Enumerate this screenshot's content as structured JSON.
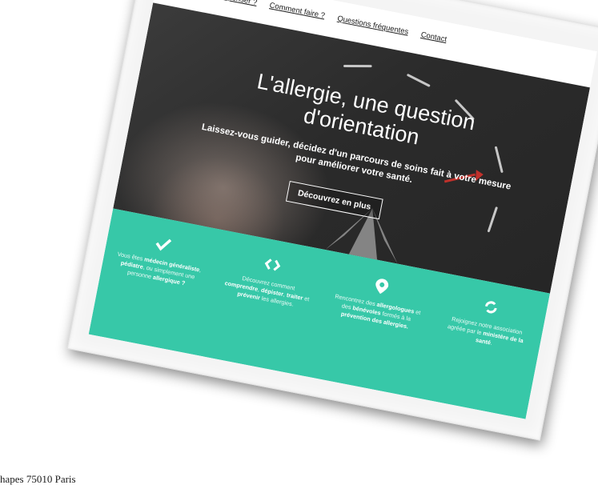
{
  "nav": {
    "logo_icon": "compass-icon",
    "links": [
      "Quand y penser ?",
      "Comment faire ?",
      "Questions fréquentes",
      "Contact"
    ]
  },
  "hero": {
    "title": "L'allergie, une question d'orientation",
    "subtitle": "Laissez-vous guider, décidez d'un parcours de soins fait à votre mesure pour améliorer votre santé.",
    "button_label": "Découvrez en plus"
  },
  "features": [
    {
      "icon": "checkmark-icon",
      "parts": [
        {
          "t": "Vous êtes ",
          "b": false
        },
        {
          "t": "médecin généraliste",
          "b": true
        },
        {
          "t": ", ",
          "b": false
        },
        {
          "t": "pédiatre",
          "b": true
        },
        {
          "t": ", ou simplement une personne ",
          "b": false
        },
        {
          "t": "allergique ?",
          "b": true
        }
      ]
    },
    {
      "icon": "code-brackets-icon",
      "parts": [
        {
          "t": "Découvrez comment ",
          "b": false
        },
        {
          "t": "comprendre",
          "b": true
        },
        {
          "t": ", ",
          "b": false
        },
        {
          "t": "dépister",
          "b": true
        },
        {
          "t": ", ",
          "b": false
        },
        {
          "t": "traiter",
          "b": true
        },
        {
          "t": " et ",
          "b": false
        },
        {
          "t": "prévenir",
          "b": true
        },
        {
          "t": " les allergies.",
          "b": false
        }
      ]
    },
    {
      "icon": "map-pin-icon",
      "parts": [
        {
          "t": "Rencontrez des ",
          "b": false
        },
        {
          "t": "allergologues",
          "b": true
        },
        {
          "t": " et des ",
          "b": false
        },
        {
          "t": "bénévoles",
          "b": true
        },
        {
          "t": " formés à la ",
          "b": false
        },
        {
          "t": "prévention des allergies.",
          "b": true
        }
      ]
    },
    {
      "icon": "refresh-icon",
      "parts": [
        {
          "t": "Rejoignez notre association agréée par le ",
          "b": false
        },
        {
          "t": "ministère de la santé",
          "b": true
        },
        {
          "t": ".",
          "b": false
        }
      ]
    }
  ],
  "footer": {
    "address": "hapes 75010 Paris"
  },
  "colors": {
    "accent": "#37c8a8",
    "hero_arrow": "#c0312b"
  }
}
